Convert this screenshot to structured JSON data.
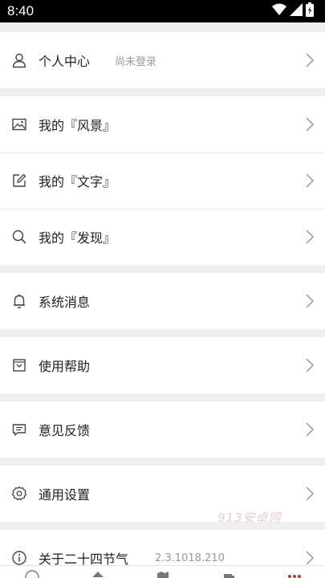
{
  "status_bar": {
    "time": "8:40"
  },
  "menu": {
    "profile": {
      "label": "个人中心",
      "status": "尚未登录"
    },
    "scenery": {
      "label": "我的『风景』"
    },
    "text": {
      "label": "我的『文字』"
    },
    "discover": {
      "label": "我的『发现』"
    },
    "notifications": {
      "label": "系统消息"
    },
    "help": {
      "label": "使用帮助"
    },
    "feedback": {
      "label": "意见反馈"
    },
    "settings": {
      "label": "通用设置"
    },
    "about": {
      "label": "关于二十四节气",
      "version": "2.3.1018.210"
    }
  },
  "watermark": "913安卓网",
  "icons": {
    "profile": "user-icon",
    "scenery": "image-icon",
    "text": "edit-icon",
    "discover": "search-icon",
    "notifications": "bell-icon",
    "help": "help-icon",
    "feedback": "message-icon",
    "settings": "gear-icon",
    "about": "info-icon",
    "chevron": "chevron-right-icon"
  },
  "colors": {
    "accent": "#c0392b",
    "text": "#222222",
    "secondary": "#9a9a9a",
    "background": "#efefef"
  }
}
